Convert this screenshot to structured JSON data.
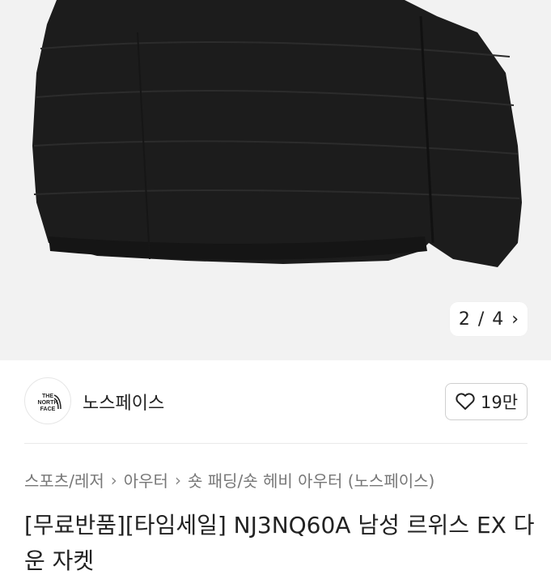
{
  "hero": {
    "pager_current": "2",
    "pager_separator": "/",
    "pager_total": "4",
    "pager_next": "›"
  },
  "seller": {
    "logo_text": [
      "THE",
      "NORTH",
      "FACE"
    ],
    "name": "노스페이스",
    "like_icon": "heart-icon",
    "like_count": "19만"
  },
  "breadcrumb": {
    "items": [
      "스포츠/레저",
      "아우터",
      "숏 패딩/숏 헤비 아우터 (노스페이스)"
    ],
    "separator": ">"
  },
  "product": {
    "title": "[무료반품][타임세일] NJ3NQ60A 남성 르위스 EX 다운 자켓"
  },
  "colors": {
    "hero_bg": "#f2f2f2",
    "jacket": "#1c1c1c"
  }
}
